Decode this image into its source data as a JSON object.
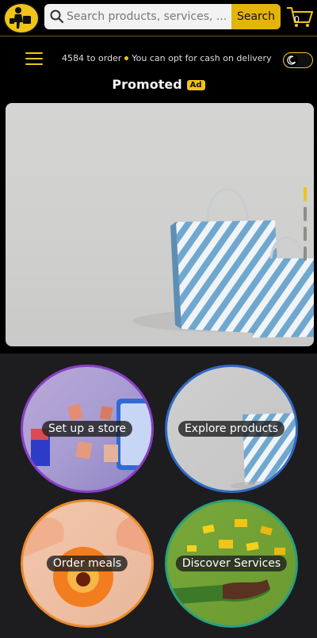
{
  "header": {
    "search_placeholder": "Search products, services, ...",
    "search_button": "Search",
    "cart_count": "0"
  },
  "nav": {
    "ticker_part1": "4584 to order",
    "ticker_part2": "You can opt for cash on delivery"
  },
  "promo": {
    "title": "Promoted",
    "badge": "Ad"
  },
  "categories": [
    {
      "label": "Set up a store"
    },
    {
      "label": "Explore products"
    },
    {
      "label": "Order meals"
    },
    {
      "label": "Discover Services"
    }
  ],
  "colors": {
    "accent": "#f0c419",
    "background": "#000000"
  }
}
